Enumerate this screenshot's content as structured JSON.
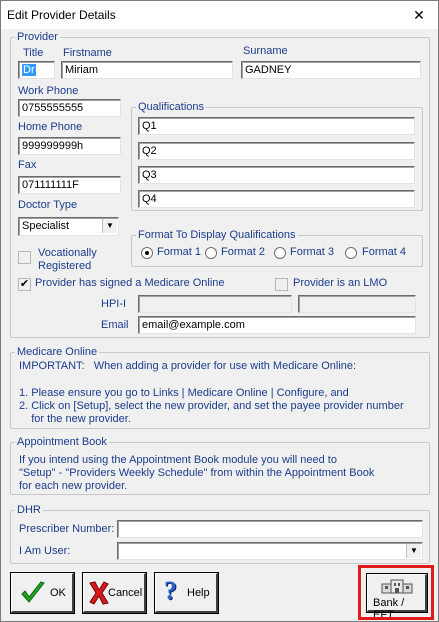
{
  "window": {
    "title": "Edit Provider Details",
    "close_symbol": "✕"
  },
  "provider": {
    "legend": "Provider",
    "title_label": "Title",
    "title_value": "Dr",
    "firstname_label": "Firstname",
    "firstname_value": "Miriam",
    "surname_label": "Surname",
    "surname_value": "GADNEY",
    "work_phone_label": "Work Phone",
    "work_phone_value": "0755555555",
    "home_phone_label": "Home Phone",
    "home_phone_value": "999999999h",
    "fax_label": "Fax",
    "fax_value": "071111111F",
    "doctor_type_label": "Doctor Type",
    "doctor_type_value": "Specialist",
    "vocationally_label_line1": "Vocationally",
    "vocationally_label_line2": "Registered",
    "medicare_online_signed_label": "Provider has signed a Medicare Online",
    "medicare_online_signed_checked": true,
    "lmo_label": "Provider is an LMO",
    "hpii_label": "HPI-I",
    "email_label": "Email",
    "email_value": "email@example.com"
  },
  "qualifications": {
    "legend": "Qualifications",
    "items": [
      "Q1",
      "Q2",
      "Q3",
      "Q4"
    ]
  },
  "format": {
    "legend": "Format To Display Qualifications",
    "options": [
      "Format 1",
      "Format 2",
      "Format 3",
      "Format 4"
    ],
    "selected_index": 0
  },
  "medicare_online": {
    "legend": "Medicare Online",
    "line1": "IMPORTANT:   When adding a provider for use with Medicare Online:",
    "line2": "1. Please ensure you go to Links | Medicare Online | Configure, and",
    "line3": "2. Click on [Setup], select the new provider, and set the payee provider number",
    "line4": "    for the new provider."
  },
  "appointment_book": {
    "legend": "Appointment Book",
    "line1": "If you intend using the Appointment Book module you will need to",
    "line2": "\"Setup\" - \"Providers Weekly Schedule\" from within the Appointment Book",
    "line3": "for each new provider."
  },
  "dhr": {
    "legend": "DHR",
    "prescriber_label": "Prescriber Number:",
    "i_am_user_label": "I Am User:"
  },
  "buttons": {
    "ok": "OK",
    "cancel": "Cancel",
    "help": "Help",
    "bank": "Bank / EFT"
  },
  "colors": {
    "label_blue": "#1a3d8c",
    "highlight_red": "#e11b1b",
    "selection_blue": "#3399ff"
  }
}
